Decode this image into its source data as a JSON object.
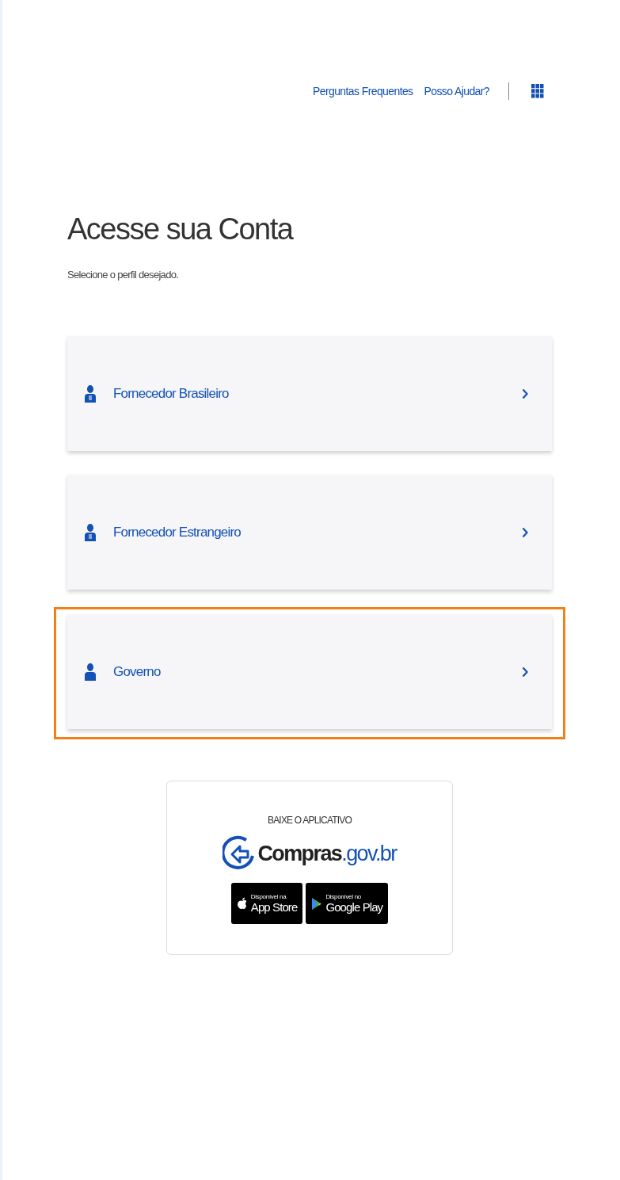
{
  "header_links": [
    "Perguntas Frequentes",
    "Posso Ajudar?"
  ],
  "title": "Acesse sua Conta",
  "subtitle": "Selecione o perfil desejado.",
  "profiles": [
    {
      "label": "Fornecedor Brasileiro",
      "kind": "suit",
      "highlighted": false
    },
    {
      "label": "Fornecedor Estrangeiro",
      "kind": "suit",
      "highlighted": false
    },
    {
      "label": "Governo",
      "kind": "plain",
      "highlighted": true
    }
  ],
  "app_card": {
    "heading": "BAIXE O APLICATIVO",
    "logo_text": "Compras",
    "logo_domain": ".gov.br",
    "stores": [
      {
        "kind": "apple",
        "small": "Disponível na",
        "name": "App Store"
      },
      {
        "kind": "google",
        "small": "Disponível no",
        "name": "Google Play"
      }
    ]
  }
}
